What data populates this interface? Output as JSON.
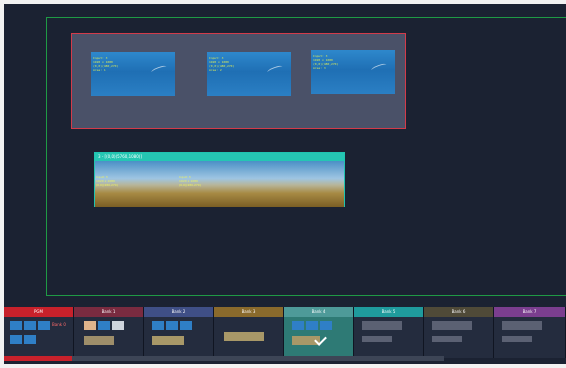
{
  "canvas": {
    "window_group": {
      "windows": [
        {
          "lines": [
            "Input: 3",
            "1920 x 1080",
            "(0,0)(480,270)",
            "Area: 1"
          ]
        },
        {
          "lines": [
            "Input: 3",
            "1920 x 1080",
            "(0,0)(480,270)",
            "Area: 2"
          ]
        },
        {
          "lines": [
            "Input: 3",
            "1920 x 1080",
            "(0,0)(480,270)",
            "Area: 3"
          ]
        }
      ]
    },
    "spanned_window": {
      "title": "3 - [(0,0)(5760,1080)]",
      "panel_lines": [
        "Input: 3",
        "1920 x 1080",
        "(0,0)(480,270)"
      ]
    }
  },
  "banks": [
    {
      "label": "PGM",
      "color": "#c8212b",
      "extra": "Bank 0"
    },
    {
      "label": "Bank 1",
      "color": "#7a2b40"
    },
    {
      "label": "Bank 2",
      "color": "#3f4f86"
    },
    {
      "label": "Bank 3",
      "color": "#8a6a2c"
    },
    {
      "label": "Bank 4",
      "color": "#4e9a99"
    },
    {
      "label": "Bank 5",
      "color": "#1f9b9d"
    },
    {
      "label": "Bank 6",
      "color": "#4f4a38"
    },
    {
      "label": "Bank 7",
      "color": "#7b3e8f"
    }
  ],
  "colors": {
    "canvas_border": "#1f9a45",
    "group_border": "#d23b4a",
    "spanned_header": "#25c6b3",
    "background": "#1b2232"
  }
}
